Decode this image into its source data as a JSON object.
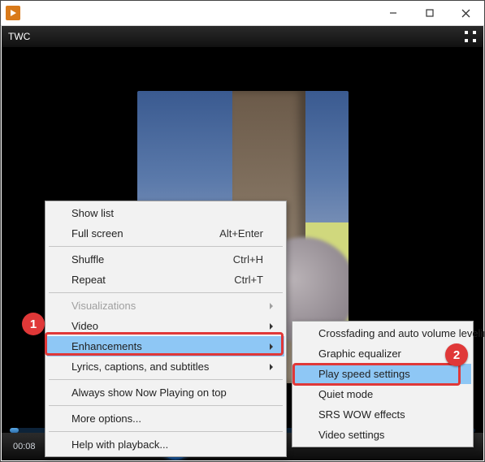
{
  "player": {
    "title": "TWC",
    "time": "00:08"
  },
  "menu": [
    {
      "label": "Show list"
    },
    {
      "label": "Full screen",
      "shortcut": "Alt+Enter"
    },
    {
      "label": "Shuffle",
      "shortcut": "Ctrl+H"
    },
    {
      "label": "Repeat",
      "shortcut": "Ctrl+T"
    },
    {
      "label": "Visualizations"
    },
    {
      "label": "Video"
    },
    {
      "label": "Enhancements"
    },
    {
      "label": "Lyrics, captions, and subtitles"
    },
    {
      "label": "Always show Now Playing on top"
    },
    {
      "label": "More options..."
    },
    {
      "label": "Help with playback..."
    }
  ],
  "submenu": [
    "Crossfading and auto volume leveling",
    "Graphic equalizer",
    "Play speed settings",
    "Quiet mode",
    "SRS WOW effects",
    "Video settings"
  ],
  "annotations": [
    "1",
    "2"
  ]
}
